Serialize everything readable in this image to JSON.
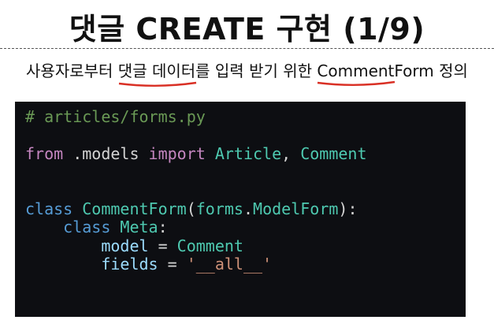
{
  "slide": {
    "title": "댓글 CREATE 구현 (1/9)",
    "subtitle": {
      "part1": "사용자로부터 ",
      "highlight1": "댓글 데이터를 입력",
      "part2": " 받기 위한 ",
      "highlight2": "CommentForm",
      "part3": " 정의"
    }
  },
  "code": {
    "comment": "# articles/forms.py",
    "l3": {
      "from": "from",
      "module": " .models ",
      "import": "import",
      "cls1": " Article",
      "comma": ", ",
      "cls2": "Comment"
    },
    "l6": {
      "class": "class",
      "name": " CommentForm",
      "paren": "(",
      "forms": "forms",
      "dot": ".",
      "base": "ModelForm",
      "end": "):"
    },
    "l7": {
      "indent": "    ",
      "class": "class",
      "name": " Meta",
      "colon": ":"
    },
    "l8": {
      "indent": "        ",
      "var": "model",
      "eq": " = ",
      "value": "Comment"
    },
    "l9": {
      "indent": "        ",
      "var": "fields",
      "eq": " = ",
      "value": "'__all__'"
    }
  },
  "colors": {
    "underline": "#d93025",
    "panel_background": "#0d0e12"
  }
}
